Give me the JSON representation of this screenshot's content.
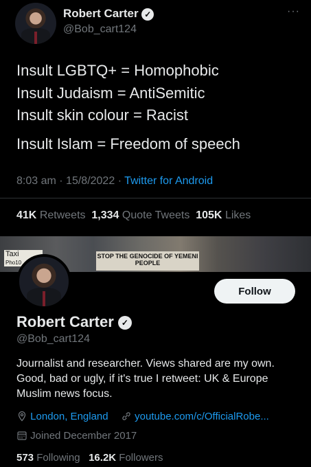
{
  "tweet": {
    "author": {
      "name": "Robert Carter",
      "handle": "@Bob_cart124",
      "verified_icon": "verified-badge-icon"
    },
    "more_label": "···",
    "lines": [
      "Insult LGBTQ+ = Homophobic",
      "Insult Judaism = AntiSemitic",
      "Insult skin colour = Racist",
      "Insult Islam = Freedom of speech"
    ],
    "time": "8:03 am",
    "date": "15/8/2022",
    "separator": "·",
    "source": "Twitter for Android",
    "stats": {
      "retweets_value": "41K",
      "retweets_label": "Retweets",
      "quotes_value": "1,334",
      "quotes_label": "Quote Tweets",
      "likes_value": "105K",
      "likes_label": "Likes"
    }
  },
  "profile": {
    "banner": {
      "sign_left": "Taxi",
      "sign_left_sub": "Pho10",
      "sign_main": "STOP THE GENOCIDE OF YEMENI PEOPLE"
    },
    "follow_label": "Follow",
    "name": "Robert Carter",
    "handle": "@Bob_cart124",
    "bio": "Journalist and researcher. Views shared are my own. Good, bad or ugly, if it's true I retweet: UK & Europe Muslim news focus.",
    "location": "London, England",
    "website": "youtube.com/c/OfficialRobe...",
    "joined": "Joined December 2017",
    "following_count": "573",
    "following_label": "Following",
    "followers_count": "16.2K",
    "followers_label": "Followers"
  },
  "colors": {
    "background": "#000000",
    "text": "#e7e9ea",
    "secondary": "#71767b",
    "accent": "#1d9bf0"
  }
}
